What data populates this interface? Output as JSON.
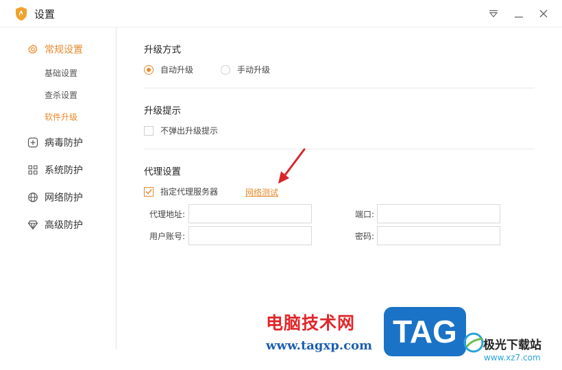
{
  "window": {
    "title": "设置"
  },
  "colors": {
    "accent": "#e8892b",
    "watermark_red": "#e0262a",
    "watermark_blue": "#1d5fb0",
    "tag_bg": "#1a73c6"
  },
  "sidebar": {
    "groups": [
      {
        "label": "常规设置",
        "icon": "gear-icon",
        "active": true
      },
      {
        "label": "病毒防护",
        "icon": "plus-square-icon",
        "active": false
      },
      {
        "label": "系统防护",
        "icon": "grid-icon",
        "active": false
      },
      {
        "label": "网络防护",
        "icon": "globe-icon",
        "active": false
      },
      {
        "label": "高级防护",
        "icon": "diamond-icon",
        "active": false
      }
    ],
    "sub_items": [
      {
        "label": "基础设置",
        "active": false
      },
      {
        "label": "查杀设置",
        "active": false
      },
      {
        "label": "软件升级",
        "active": true
      }
    ]
  },
  "main": {
    "upgrade_method": {
      "title": "升级方式",
      "options": [
        {
          "label": "自动升级",
          "selected": true
        },
        {
          "label": "手动升级",
          "selected": false
        }
      ]
    },
    "upgrade_prompt": {
      "title": "升级提示",
      "checkbox_label": "不弹出升级提示",
      "checked": false
    },
    "proxy": {
      "title": "代理设置",
      "checkbox_label": "指定代理服务器",
      "checked": true,
      "test_link": "网络测试",
      "fields": {
        "address_label": "代理地址:",
        "address_value": "",
        "port_label": "端口:",
        "port_value": "",
        "user_label": "用户账号:",
        "user_value": "",
        "password_label": "密码:",
        "password_value": ""
      }
    }
  },
  "watermark": {
    "site_cn": "电脑技术网",
    "site_url": "www.tagxp.com",
    "tag": "TAG",
    "site2_cn": "极光下载站",
    "site2_url": "www.xz7.com"
  }
}
